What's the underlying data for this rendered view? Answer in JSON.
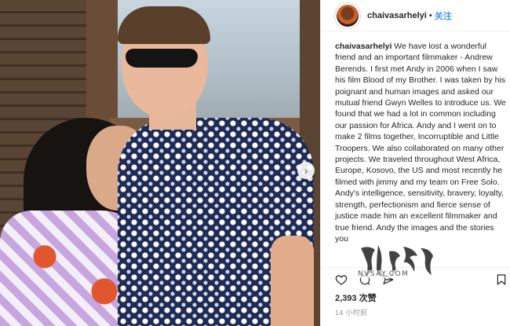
{
  "post": {
    "username": "chaivasarhelyi",
    "separator": "•",
    "follow_label": "关注",
    "caption_user": "chaivasarhelyi",
    "caption_text": " We have lost a wonderful friend and an important filmmaker - Andrew Berends. I first met Andy in 2006 when I saw his film Blood of my Brother. I was taken by his poignant and human images and asked our mutual friend Gwyn Welles to introduce us. We found that we had a lot in common including our passion for Africa. Andy and I went on to make 2 films together, Incorruptible and Little Troopers. We also collaborated on many other projects. We traveled throughout West Africa, Europe, Kosovo, the US and most recently he filmed with jimmy and my team on Free Solo. Andy's intelligence, sensitivity, bravery, loyalty, strength, perfectionism and fierce sense of justice made him an excellent filmmaker and true friend. Andy the images and the stories you",
    "likes": "2,393 次赞",
    "time": "14 小时前"
  },
  "photo": {
    "next_glyph": "›"
  },
  "watermark": {
    "label": "女人说",
    "url_text": "NVSAY.COM"
  },
  "icons": {
    "avatar": "avatar",
    "next": "chevron-right-icon",
    "like": "heart-icon",
    "comment": "comment-icon",
    "share": "share-icon",
    "save": "bookmark-icon"
  },
  "colors": {
    "link_blue": "#3897f0",
    "text": "#262626",
    "muted": "#999999"
  }
}
